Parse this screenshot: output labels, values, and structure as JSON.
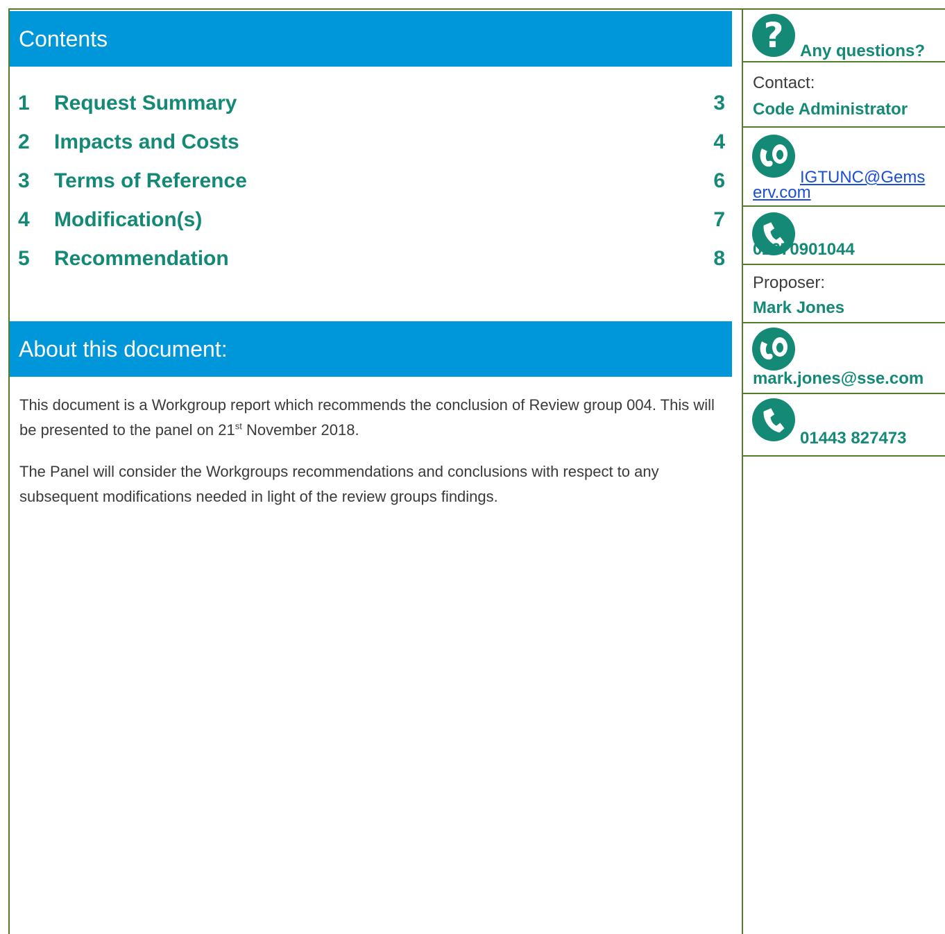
{
  "contents": {
    "heading": "Contents",
    "items": [
      {
        "num": "1",
        "title": "Request Summary",
        "page": "3"
      },
      {
        "num": "2",
        "title": "Impacts and Costs",
        "page": "4"
      },
      {
        "num": "3",
        "title": "Terms of Reference",
        "page": "6"
      },
      {
        "num": "4",
        "title": "Modification(s)",
        "page": "7"
      },
      {
        "num": "5",
        "title": "Recommendation",
        "page": "8"
      }
    ]
  },
  "about": {
    "heading": "About this document:",
    "para1_a": "This document is a Workgroup report which recommends the conclusion of Review group 004. This will be presented to the panel on 21",
    "para1_sup": "st",
    "para1_b": " November 2018.",
    "para2": "The Panel will consider the Workgroups recommendations and conclusions with respect to any subsequent modifications needed in light of the review groups findings."
  },
  "sidebar": {
    "questions_label": "Any questions?",
    "contact_label": "Contact:",
    "contact_name": "Code Administrator",
    "contact_email_a": "IGTUNC@Gems",
    "contact_email_b": "erv.com",
    "contact_phone": "02070901044",
    "proposer_label": "Proposer:",
    "proposer_name": "Mark Jones",
    "proposer_email": "mark.jones@sse.com",
    "proposer_phone": "01443 827473"
  },
  "colors": {
    "band": "#0096da",
    "accent": "#148a76",
    "rule": "#4f7d2a",
    "link": "#1a4fd6"
  }
}
